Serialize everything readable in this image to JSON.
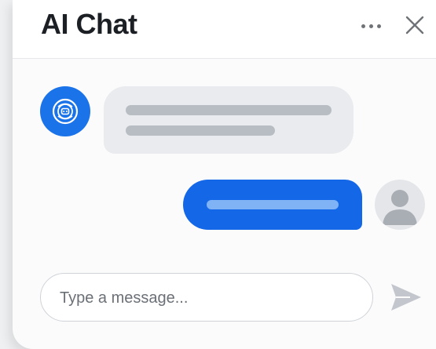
{
  "header": {
    "title": "AI Chat"
  },
  "composer": {
    "placeholder": "Type a message..."
  },
  "colors": {
    "accent": "#1467e6",
    "bot_avatar": "#1a73e8",
    "bot_bubble": "#e9ebee",
    "user_bubble_text_placeholder": "#7fb3f5"
  },
  "icons": {
    "bot_avatar": "ai-bot-icon",
    "user_avatar": "user-icon",
    "menu": "more-horizontal-icon",
    "close": "close-icon",
    "send": "send-icon"
  }
}
